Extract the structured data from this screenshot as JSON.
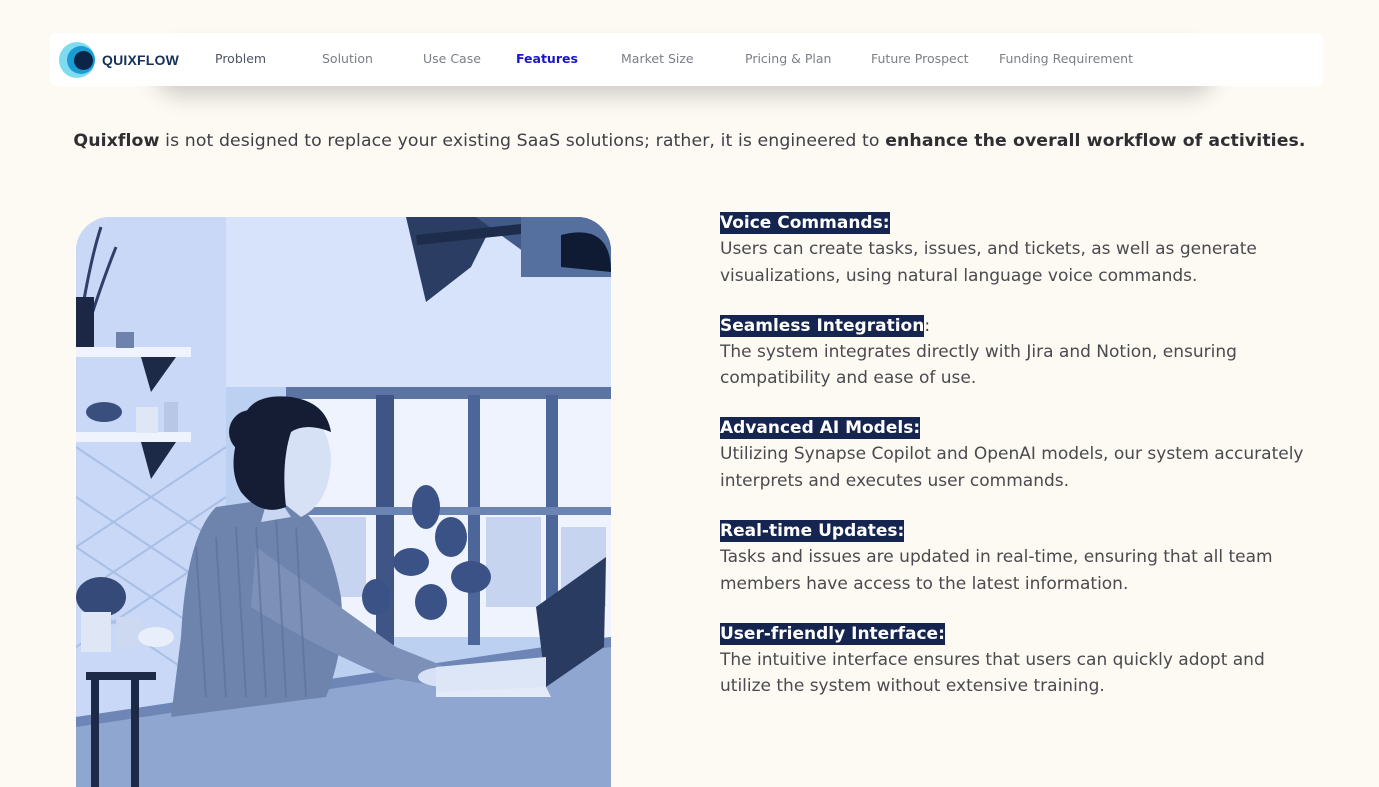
{
  "brand": {
    "name": "QUIXFLOW",
    "logo_icon": "quixflow-logo-icon",
    "colors": {
      "outer": "#7fdcf0",
      "middle": "#1a9bd1",
      "inner": "#0b2548"
    }
  },
  "nav": {
    "items": [
      {
        "label": "Problem"
      },
      {
        "label": "Solution"
      },
      {
        "label": "Use Case"
      },
      {
        "label": "Features"
      },
      {
        "label": "Market Size"
      },
      {
        "label": "Pricing & Plan"
      },
      {
        "label": "Future Prospect"
      },
      {
        "label": "Funding Requirement"
      }
    ],
    "active": "Features",
    "active_color": "#1b14c9"
  },
  "intro": {
    "brand_word": "Quixflow",
    "middle_text": " is not designed to replace your existing SaaS solutions; rather, it is engineered to ",
    "emphasis": "enhance the overall workflow of activities."
  },
  "image": {
    "alt": "woman working on a laptop"
  },
  "features": [
    {
      "title": "Voice Commands",
      "suffix": ":",
      "description": "Users can create tasks, issues, and tickets, as well as generate visualizations, using natural language voice commands."
    },
    {
      "title": "Seamless Integration",
      "suffix": ":",
      "description": "The system integrates directly with Jira and Notion, ensuring compatibility and ease of use."
    },
    {
      "title": "Advanced AI Models",
      "suffix": ":",
      "description": "Utilizing Synapse Copilot and OpenAI models, our system accurately interprets and executes user commands."
    },
    {
      "title": "Real-time Updates",
      "suffix": ":",
      "description": "Tasks and issues are updated in real-time, ensuring that all team members have access to the latest information."
    },
    {
      "title": "User-friendly Interface",
      "suffix": ":",
      "description": "The intuitive interface ensures that users can quickly adopt and utilize the system without extensive training."
    }
  ],
  "colors": {
    "background": "#fdf9f3",
    "title_highlight": "#16254f",
    "photo_tint": "#b9cdef"
  }
}
